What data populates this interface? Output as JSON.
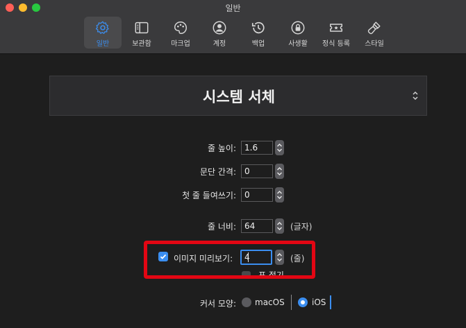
{
  "window": {
    "title": "일반"
  },
  "toolbar": {
    "tabs": [
      {
        "label": "일반",
        "icon": "gear-icon",
        "active": true
      },
      {
        "label": "보관함",
        "icon": "sidebar-icon",
        "active": false
      },
      {
        "label": "마크업",
        "icon": "palette-icon",
        "active": false
      },
      {
        "label": "계정",
        "icon": "person-icon",
        "active": false
      },
      {
        "label": "백업",
        "icon": "history-icon",
        "active": false
      },
      {
        "label": "사생활",
        "icon": "lock-icon",
        "active": false
      },
      {
        "label": "정식 등록",
        "icon": "ticket-icon",
        "active": false
      },
      {
        "label": "스타일",
        "icon": "brush-icon",
        "active": false
      }
    ]
  },
  "font": {
    "name": "시스템 서체"
  },
  "settings": {
    "line_height": {
      "label": "줄 높이:",
      "value": "1.6"
    },
    "paragraph_spacing": {
      "label": "문단 간격:",
      "value": "0"
    },
    "first_line_indent": {
      "label": "첫 줄 들여쓰기:",
      "value": "0"
    },
    "line_width": {
      "label": "줄 너비:",
      "value": "64",
      "unit": "(글자)"
    },
    "image_preview": {
      "label": "이미지 미리보기:",
      "value": "4",
      "unit": "(줄)",
      "checked": true
    },
    "cut_off_label": "표 접기",
    "cursor_shape": {
      "label": "커서 모양:",
      "options": [
        {
          "label": "macOS",
          "selected": false
        },
        {
          "label": "iOS",
          "selected": true
        }
      ]
    }
  },
  "colors": {
    "accent": "#3b8ef0",
    "highlight_box": "#e30613",
    "background": "#1e1e1e",
    "toolbar_bg": "#3a3a3c"
  }
}
